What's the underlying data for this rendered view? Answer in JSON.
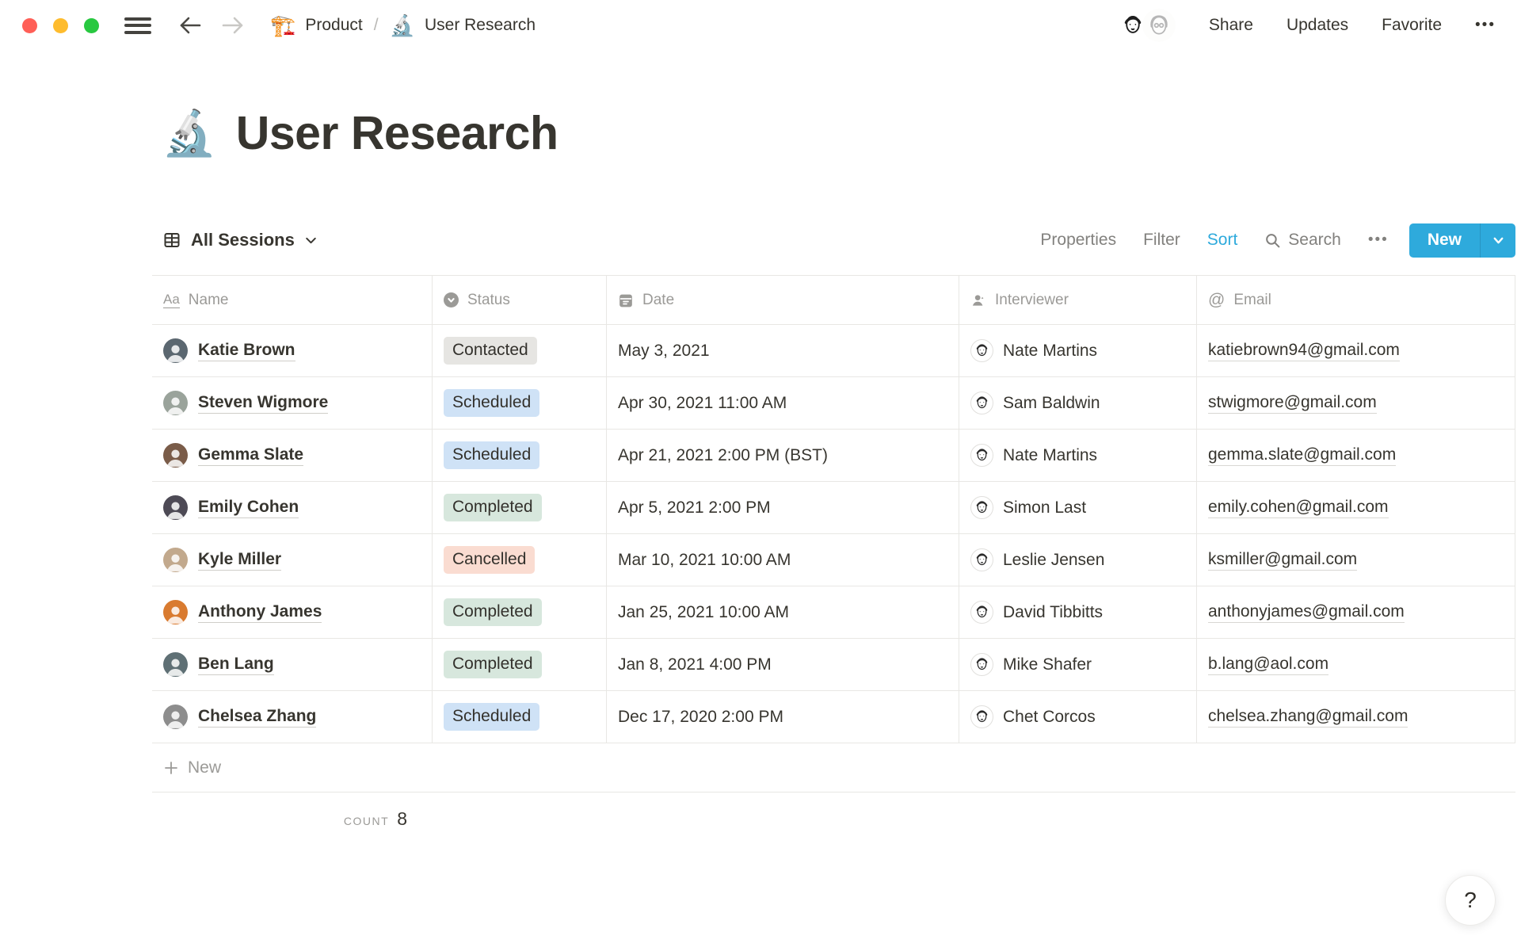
{
  "topbar": {
    "breadcrumb": {
      "parent_icon": "🏗️",
      "parent_label": "Product",
      "separator": "/",
      "page_icon": "🔬",
      "page_label": "User Research"
    },
    "actions": {
      "share": "Share",
      "updates": "Updates",
      "favorite": "Favorite",
      "more": "•••"
    }
  },
  "page": {
    "icon": "🔬",
    "title": "User Research"
  },
  "view_bar": {
    "view_name": "All Sessions",
    "properties": "Properties",
    "filter": "Filter",
    "sort": "Sort",
    "search": "Search",
    "more": "•••",
    "new_label": "New"
  },
  "table": {
    "columns": [
      {
        "label": "Name",
        "icon_glyph": "Aa"
      },
      {
        "label": "Status"
      },
      {
        "label": "Date"
      },
      {
        "label": "Interviewer"
      },
      {
        "label": "Email",
        "icon_glyph": "@"
      }
    ],
    "rows": [
      {
        "name": "Katie Brown",
        "avatar_color": "#5b6770",
        "status": "Contacted",
        "date": "May 3, 2021",
        "interviewer": "Nate Martins",
        "email": "katiebrown94@gmail.com"
      },
      {
        "name": "Steven Wigmore",
        "avatar_color": "#9aa39b",
        "status": "Scheduled",
        "date": "Apr 30, 2021 11:00 AM",
        "interviewer": "Sam Baldwin",
        "email": "stwigmore@gmail.com"
      },
      {
        "name": "Gemma Slate",
        "avatar_color": "#7a5c49",
        "status": "Scheduled",
        "date": "Apr 21, 2021 2:00 PM (BST)",
        "interviewer": "Nate Martins",
        "email": "gemma.slate@gmail.com"
      },
      {
        "name": "Emily Cohen",
        "avatar_color": "#4d4a55",
        "status": "Completed",
        "date": "Apr 5, 2021 2:00 PM",
        "interviewer": "Simon Last",
        "email": "emily.cohen@gmail.com"
      },
      {
        "name": "Kyle Miller",
        "avatar_color": "#c2a98d",
        "status": "Cancelled",
        "date": "Mar 10, 2021 10:00 AM",
        "interviewer": "Leslie Jensen",
        "email": "ksmiller@gmail.com"
      },
      {
        "name": "Anthony James",
        "avatar_color": "#d97b30",
        "status": "Completed",
        "date": "Jan 25, 2021 10:00 AM",
        "interviewer": "David Tibbitts",
        "email": "anthonyjames@gmail.com"
      },
      {
        "name": "Ben Lang",
        "avatar_color": "#5f7075",
        "status": "Completed",
        "date": "Jan 8, 2021 4:00 PM",
        "interviewer": "Mike Shafer",
        "email": "b.lang@aol.com"
      },
      {
        "name": "Chelsea Zhang",
        "avatar_color": "#8d8d8d",
        "status": "Scheduled",
        "date": "Dec 17, 2020 2:00 PM",
        "interviewer": "Chet Corcos",
        "email": "chelsea.zhang@gmail.com"
      }
    ],
    "new_row_label": "New",
    "count_label": "COUNT",
    "count_value": "8"
  },
  "help": {
    "label": "?"
  },
  "colors": {
    "accent": "#2EAADC",
    "text": "#37352F",
    "gray_text": "#9B9A97",
    "border": "#E8E7E4",
    "traffic_lights": {
      "close": "#FF5F57",
      "minimize": "#FEBC2E",
      "zoom": "#28C840"
    },
    "status": {
      "Contacted": "#E6E5E2",
      "Scheduled": "#CFE2F6",
      "Completed": "#D7E7DD",
      "Cancelled": "#FADCD1"
    }
  }
}
